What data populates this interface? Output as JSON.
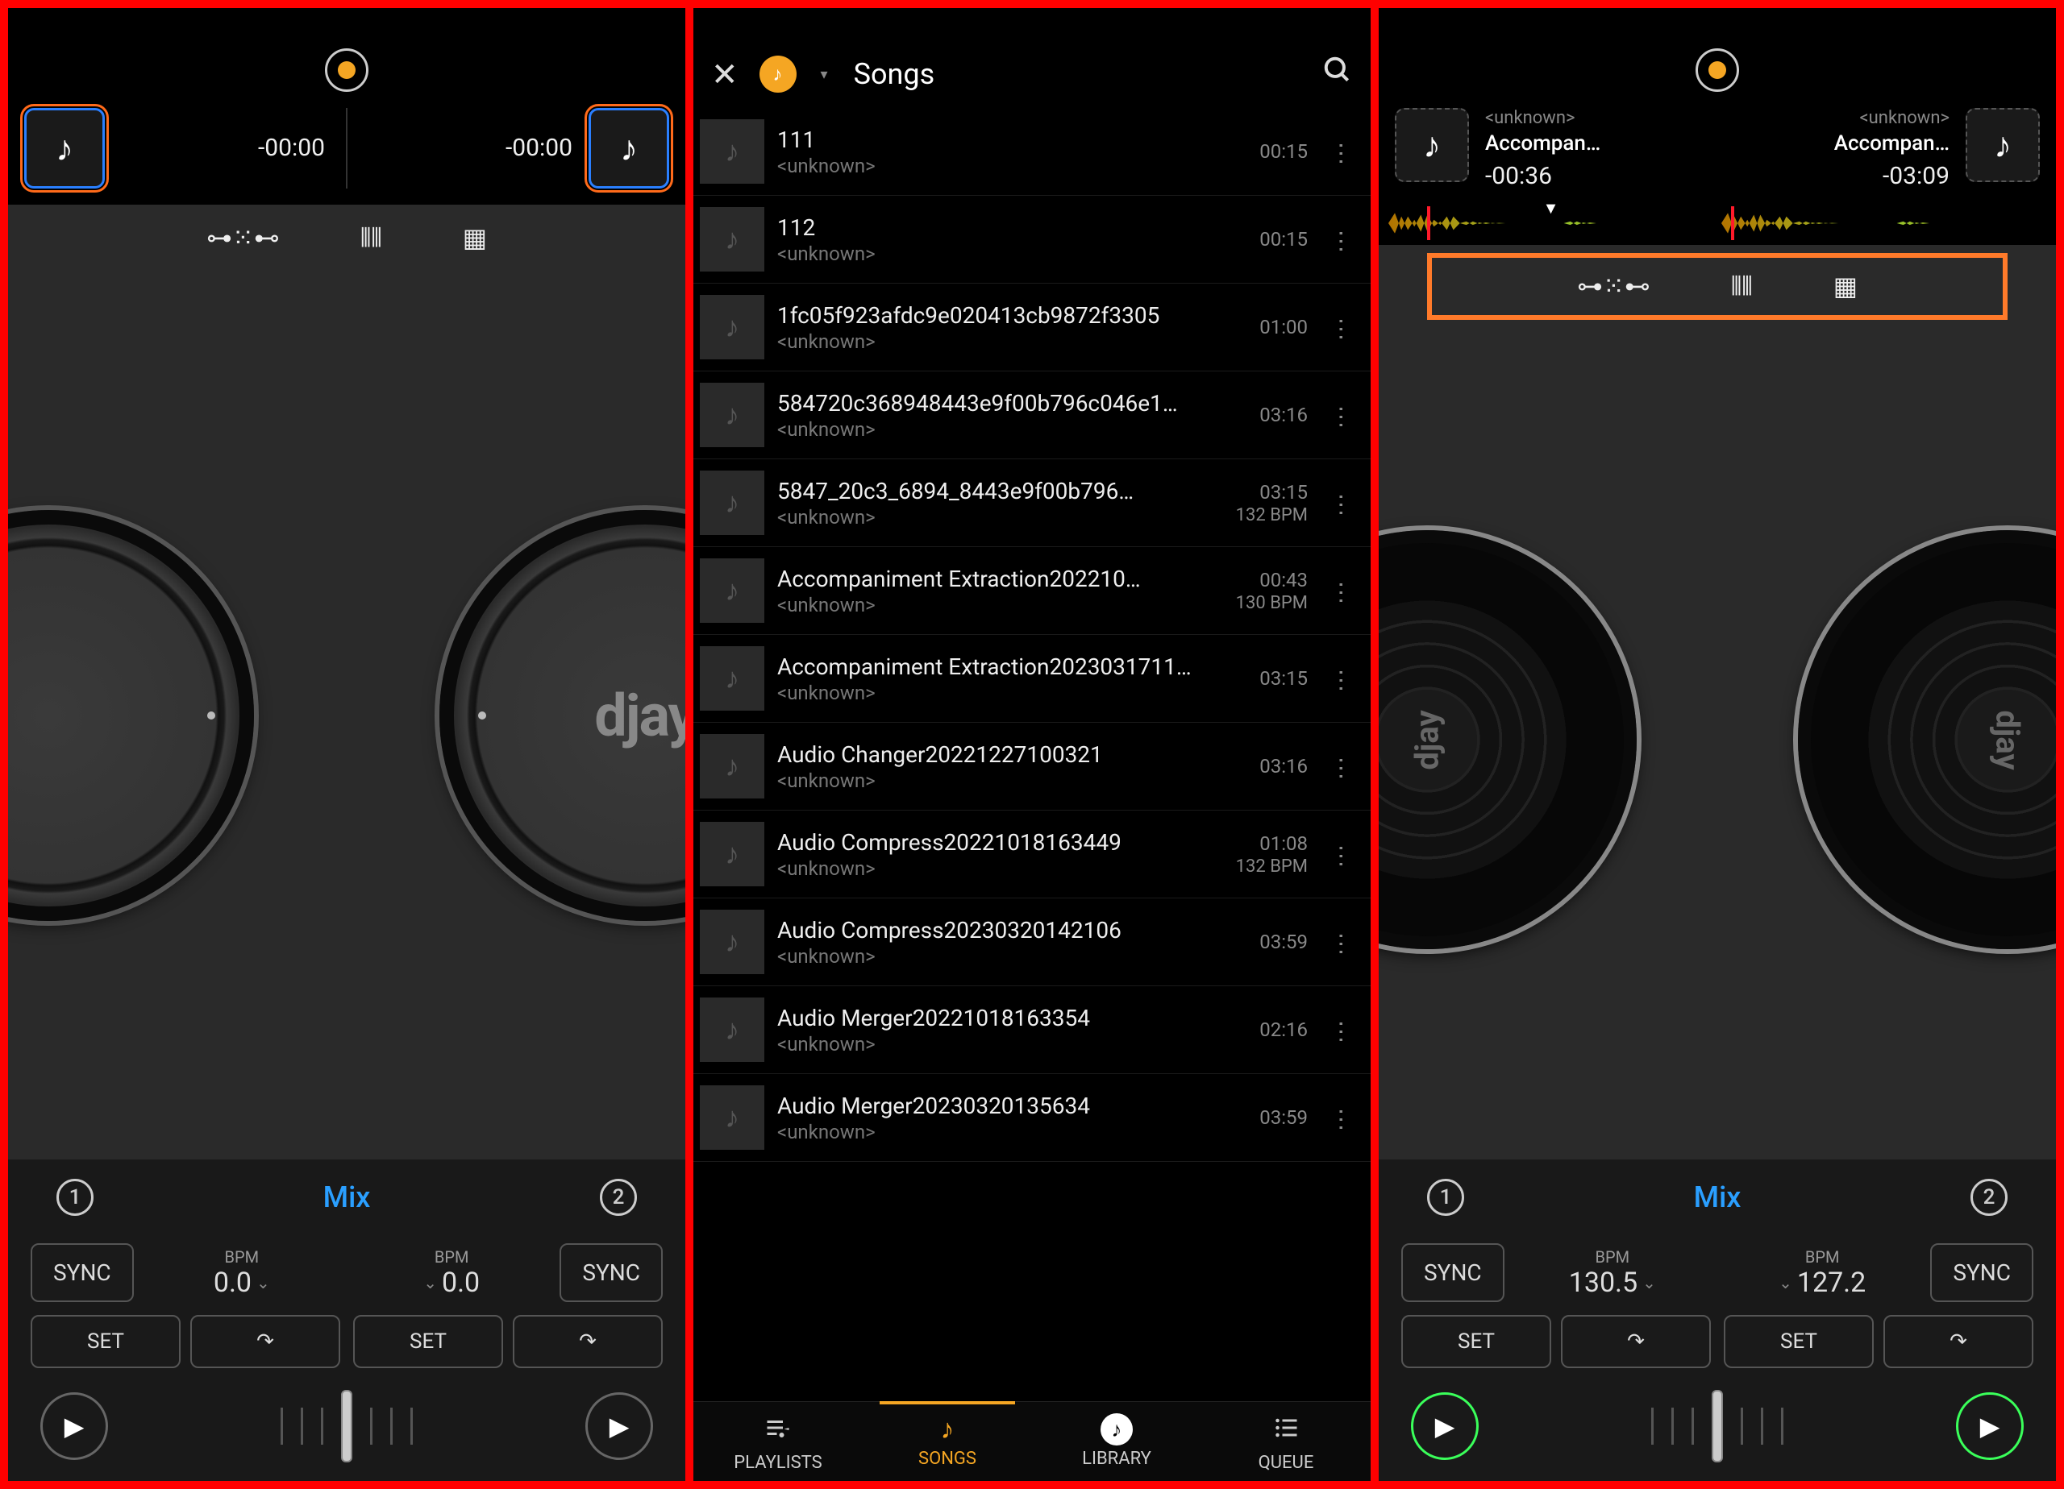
{
  "screen1": {
    "deckA": {
      "time": "-00:00"
    },
    "deckB": {
      "time": "-00:00"
    },
    "platter_label": "djay",
    "mix_label": "Mix",
    "ch1": "1",
    "ch2": "2",
    "sync_label": "SYNC",
    "bpm_label": "BPM",
    "bpmA": "0.0",
    "bpmB": "0.0",
    "set_label": "SET"
  },
  "screen2": {
    "title": "Songs",
    "songs": [
      {
        "title": "111",
        "artist": "<unknown>",
        "dur": "00:15",
        "bpm": ""
      },
      {
        "title": "112",
        "artist": "<unknown>",
        "dur": "00:15",
        "bpm": ""
      },
      {
        "title": "1fc05f923afdc9e020413cb9872f3305",
        "artist": "<unknown>",
        "dur": "01:00",
        "bpm": ""
      },
      {
        "title": "584720c368948443e9f00b796c046e1…",
        "artist": "<unknown>",
        "dur": "03:16",
        "bpm": ""
      },
      {
        "title": "5847_20c3_6894_8443e9f00b796…",
        "artist": "<unknown>",
        "dur": "03:15",
        "bpm": "132 BPM"
      },
      {
        "title": "Accompaniment Extraction202210…",
        "artist": "<unknown>",
        "dur": "00:43",
        "bpm": "130 BPM"
      },
      {
        "title": "Accompaniment Extraction2023031711…",
        "artist": "<unknown>",
        "dur": "03:15",
        "bpm": ""
      },
      {
        "title": "Audio Changer20221227100321",
        "artist": "<unknown>",
        "dur": "03:16",
        "bpm": ""
      },
      {
        "title": "Audio Compress20221018163449",
        "artist": "<unknown>",
        "dur": "01:08",
        "bpm": "132 BPM"
      },
      {
        "title": "Audio Compress20230320142106",
        "artist": "<unknown>",
        "dur": "03:59",
        "bpm": ""
      },
      {
        "title": "Audio Merger20221018163354",
        "artist": "<unknown>",
        "dur": "02:16",
        "bpm": ""
      },
      {
        "title": "Audio Merger20230320135634",
        "artist": "<unknown>",
        "dur": "03:59",
        "bpm": ""
      }
    ],
    "tabs": {
      "playlists": "PLAYLISTS",
      "songs": "SONGS",
      "library": "LIBRARY",
      "queue": "QUEUE"
    }
  },
  "screen3": {
    "deckA": {
      "artist": "<unknown>",
      "title": "Accompan…",
      "time": "-00:36"
    },
    "deckB": {
      "artist": "<unknown>",
      "title": "Accompan…",
      "time": "-03:09"
    },
    "vinyl_label": "djay",
    "mix_label": "Mix",
    "ch1": "1",
    "ch2": "2",
    "sync_label": "SYNC",
    "bpm_label": "BPM",
    "bpmA": "130.5",
    "bpmB": "127.2",
    "set_label": "SET"
  }
}
